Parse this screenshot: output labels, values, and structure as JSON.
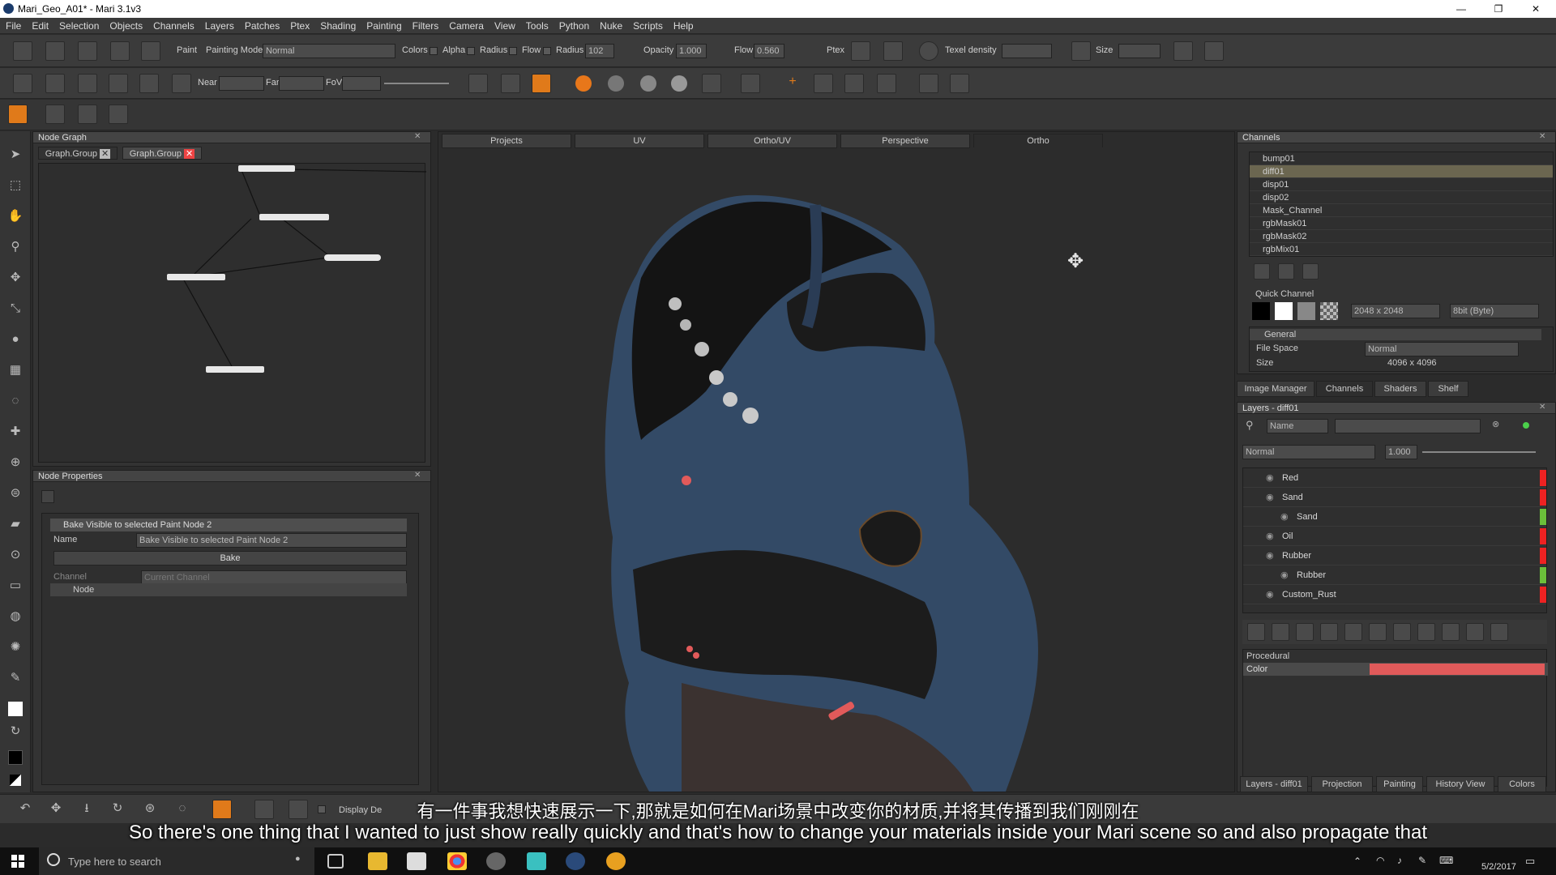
{
  "window": {
    "title": "Mari_Geo_A01* - Mari 3.1v3"
  },
  "menu": [
    "File",
    "Edit",
    "Selection",
    "Objects",
    "Channels",
    "Layers",
    "Patches",
    "Ptex",
    "Shading",
    "Painting",
    "Filters",
    "Camera",
    "View",
    "Tools",
    "Python",
    "Nuke",
    "Scripts",
    "Help"
  ],
  "toolbar1": {
    "paint": "Paint",
    "painting_mode": "Painting Mode",
    "mode_value": "Normal",
    "colors": "Colors",
    "alpha": "Alpha",
    "radius1": "Radius",
    "flow1": "Flow",
    "radius2": "Radius",
    "radius_value": "102",
    "opacity": "Opacity",
    "opacity_value": "1.000",
    "flow2": "Flow",
    "flow_value": "0.560",
    "ptex": "Ptex",
    "texel": "Texel density",
    "size": "Size"
  },
  "toolbar2": {
    "near": "Near",
    "far": "Far",
    "fov": "FoV"
  },
  "node_graph": {
    "title": "Node Graph",
    "tabs": [
      "Graph.Group",
      "Graph.Group"
    ]
  },
  "node_props": {
    "title": "Node Properties",
    "node_name": "Bake Visible to selected Paint Node 2",
    "name_label": "Name",
    "name_value": "Bake Visible to selected Paint Node 2",
    "bake": "Bake",
    "channel_label": "Channel",
    "channel_value": "Current Channel",
    "node_section": "Node"
  },
  "viewport": {
    "tabs": [
      "Projects",
      "UV",
      "Ortho/UV",
      "Perspective",
      "Ortho"
    ],
    "active": "Ortho"
  },
  "channels": {
    "title": "Channels",
    "items": [
      "bump01",
      "diff01",
      "disp01",
      "disp02",
      "Mask_Channel",
      "rgbMask01",
      "rgbMask02",
      "rgbMix01"
    ],
    "selected": "diff01",
    "quick": "Quick Channel",
    "size_value": "2048 x 2048",
    "depth_value": "8bit (Byte)",
    "general": "General",
    "file_space_label": "File Space",
    "file_space_value": "Normal",
    "size_label": "Size",
    "size_val": "4096 x 4096"
  },
  "right_tabs": [
    "Image Manager",
    "Channels",
    "Shaders",
    "Shelf"
  ],
  "layers": {
    "title": "Layers - diff01",
    "filter_label": "Name",
    "blend": "Normal",
    "opacity": "1.000",
    "items": [
      {
        "name": "Red",
        "indent": 0
      },
      {
        "name": "Sand",
        "indent": 0
      },
      {
        "name": "Sand",
        "indent": 1
      },
      {
        "name": "Oil",
        "indent": 0
      },
      {
        "name": "Rubber",
        "indent": 0
      },
      {
        "name": "Rubber",
        "indent": 1
      },
      {
        "name": "Custom_Rust",
        "indent": 0
      }
    ],
    "procedural": "Procedural",
    "color_label": "Color",
    "color": "#e05a5a"
  },
  "bottom_tabs": [
    "Layers - diff01",
    "Projection",
    "Painting",
    "History View",
    "Colors"
  ],
  "display_label": "Display De",
  "subtitles": {
    "zh": "有一件事我想快速展示一下,那就是如何在Mari场景中改变你的材质,并将其传播到我们刚刚在",
    "en": "So there's one thing that I wanted to just show really quickly and that's how to change your materials inside your Mari scene so and also propagate that"
  },
  "taskbar": {
    "search": "Type here to search",
    "date": "5/2/2017"
  }
}
